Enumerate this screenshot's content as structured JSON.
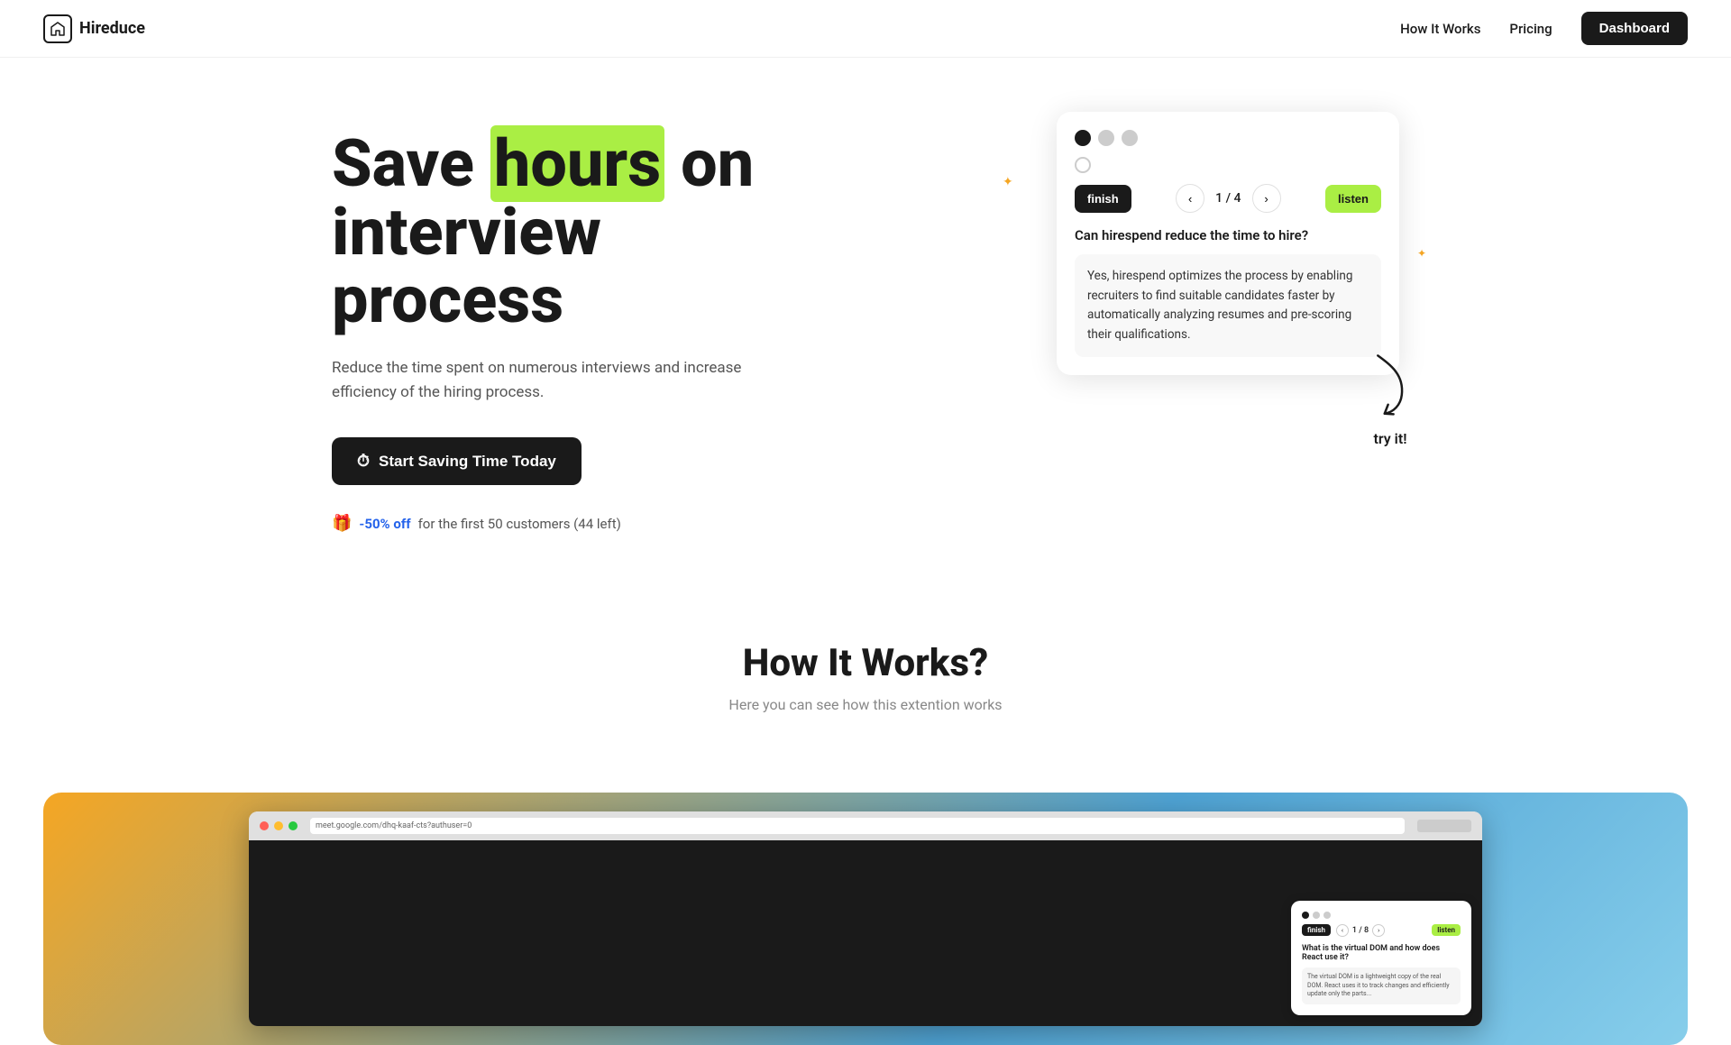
{
  "nav": {
    "logo_text": "Hireduce",
    "logo_icon": "🏠",
    "how_it_works": "How It Works",
    "pricing": "Pricing",
    "dashboard": "Dashboard"
  },
  "hero": {
    "title_part1": "Save ",
    "title_highlight": "hours",
    "title_part2": " on interview process",
    "subtitle": "Reduce the time spent on numerous interviews and increase efficiency of the hiring process.",
    "cta_label": "Start Saving Time Today",
    "promo_text": "-50% off",
    "promo_suffix": "for the first 50 customers (44 left)"
  },
  "widget": {
    "finish_label": "finish",
    "page_indicator": "1 / 4",
    "listen_label": "listen",
    "question": "Can hirespend reduce the time to hire?",
    "answer": "Yes, hirespend optimizes the process by enabling recruiters to find suitable candidates faster by automatically analyzing resumes and pre-scoring their qualifications.",
    "try_it": "try it!"
  },
  "how_section": {
    "title": "How It Works?",
    "subtitle": "Here you can see how this extention works"
  },
  "browser_mockup": {
    "url": "meet.google.com/dhq-kaaf-cts?authuser=0",
    "page_indicator": "1 / 8",
    "question": "What is the virtual DOM and how does React use it?"
  }
}
